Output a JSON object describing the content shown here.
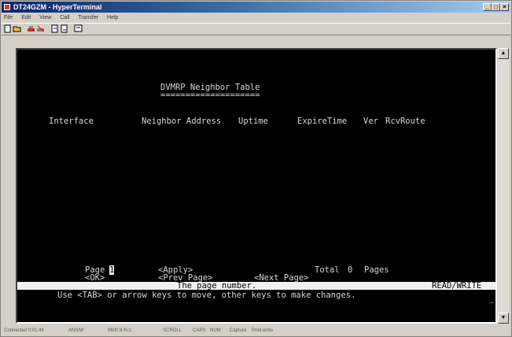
{
  "window": {
    "title": "DT24GZM - HyperTerminal"
  },
  "menu": [
    "File",
    "Edit",
    "View",
    "Call",
    "Transfer",
    "Help"
  ],
  "toolbar": {
    "buttons": [
      "new-icon",
      "open-icon",
      "call-icon",
      "disconnect-icon",
      "send-icon",
      "properties-icon"
    ]
  },
  "terminal": {
    "heading": "DVMRP Neighbor Table",
    "heading_rule": "====================",
    "columns": {
      "interface": "Interface",
      "neighbor": "Neighbor Address",
      "uptime": "Uptime",
      "expire": "ExpireTime",
      "ver": "Ver",
      "route": "RcvRoute"
    },
    "page_label": "Page",
    "page_value": "1",
    "apply": "<Apply>",
    "total": "Total",
    "total_value": "0",
    "pages": "Pages",
    "ok": "<OK>",
    "prev": "<Prev Page>",
    "next": "<Next Page>",
    "status_line": "The page number.",
    "mode": "READ/WRITE",
    "help": "Use <TAB> or arrow keys to move, other keys to make changes."
  },
  "status": {
    "connected": "Connected 0:01:44",
    "emulation": "ANSIW",
    "settings": "9600 8-N-1",
    "scroll": "SCROLL",
    "caps": "CAPS",
    "num": "NUM",
    "capture": "Capture",
    "echo": "Print echo"
  }
}
